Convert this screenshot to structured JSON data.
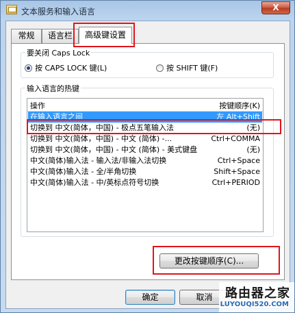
{
  "window": {
    "title": "文本服务和输入语言",
    "close_label": "X"
  },
  "tabs": [
    {
      "label": "常规"
    },
    {
      "label": "语言栏"
    },
    {
      "label": "高级键设置"
    }
  ],
  "caps_lock": {
    "group_label": "要关闭 Caps Lock",
    "options": [
      {
        "label": "按 CAPS LOCK 键(L)",
        "checked": true
      },
      {
        "label": "按 SHIFT 键(F)",
        "checked": false
      }
    ]
  },
  "hotkeys": {
    "group_label": "输入语言的热键",
    "columns": [
      "操作",
      "按键顺序(K)"
    ],
    "rows": [
      {
        "action": "在输入语言之间",
        "keys": "左 Alt+Shift",
        "selected": true
      },
      {
        "action": "切换到 中文(简体，中国) - 极点五笔输入法",
        "keys": "(无)"
      },
      {
        "action": "切换到 中文(简体，中国) - 中文 (简体) -...",
        "keys": "Ctrl+COMMA"
      },
      {
        "action": "切换到 中文(简体，中国) - 中文 (简体) - 美式键盘",
        "keys": "(无)"
      },
      {
        "action": "中文(简体)输入法 - 输入法/非输入法切换",
        "keys": "Ctrl+Space"
      },
      {
        "action": "中文(简体)输入法 - 全/半角切换",
        "keys": "Shift+Space"
      },
      {
        "action": "中文(简体)输入法 - 中/英标点符号切换",
        "keys": "Ctrl+PERIOD"
      }
    ],
    "change_button": "更改按键顺序(C)..."
  },
  "footer": {
    "ok": "确定",
    "cancel": "取消"
  },
  "watermark": {
    "title": "路由器之家",
    "url": "LUYOUQI520.COM"
  },
  "accent": {
    "highlight": "#e1131a",
    "selection": "#3399ff"
  }
}
